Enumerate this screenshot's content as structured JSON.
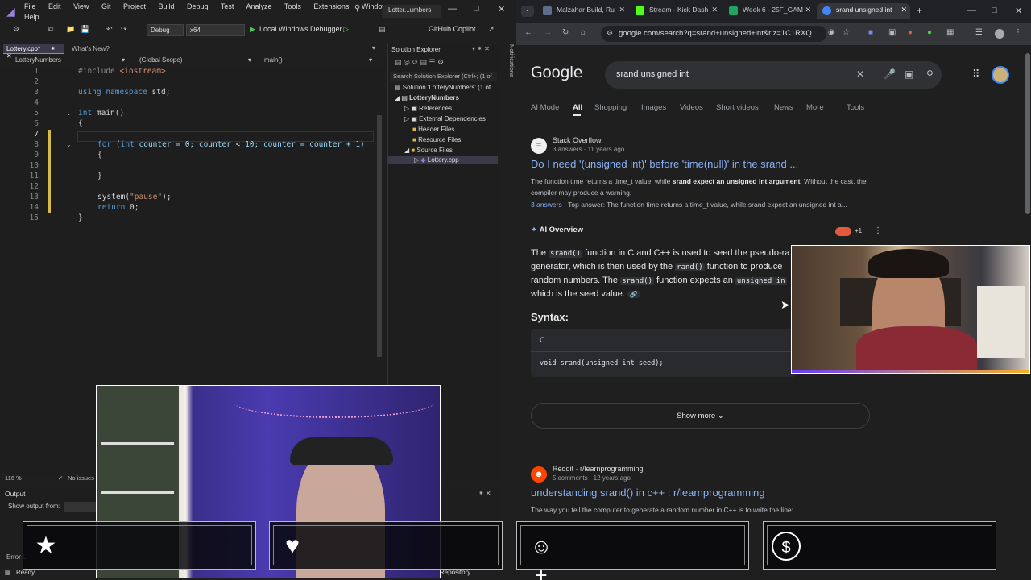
{
  "vs": {
    "menu_row1": [
      "File",
      "Edit",
      "View",
      "Git",
      "Project",
      "Build",
      "Debug",
      "Test",
      "Analyze",
      "Tools",
      "Extensions",
      "Window"
    ],
    "menu_row2": "Help",
    "search_icon": "search-icon",
    "title_short": "Lotter...umbers",
    "toolbar": {
      "config": "Debug",
      "platform": "x64",
      "run_label": "Local Windows Debugger",
      "copilot": "GitHub Copilot"
    },
    "tabs": {
      "active": "Lottery.cpp*",
      "other": "What's New?"
    },
    "nav": {
      "project": "LotteryNumbers",
      "scope": "(Global Scope)",
      "func": "main()"
    },
    "code_lines": [
      {
        "n": "1"
      },
      {
        "n": "2"
      },
      {
        "n": "3"
      },
      {
        "n": "4"
      },
      {
        "n": "5"
      },
      {
        "n": "6"
      },
      {
        "n": "7"
      },
      {
        "n": "8"
      },
      {
        "n": "9"
      },
      {
        "n": "10"
      },
      {
        "n": "11"
      },
      {
        "n": "12"
      },
      {
        "n": "13"
      },
      {
        "n": "14"
      },
      {
        "n": "15"
      }
    ],
    "code": {
      "l1a": "#include ",
      "l1b": "<iostream>",
      "l3a": "using ",
      "l3b": "namespace ",
      "l3c": "std;",
      "l5a": "int ",
      "l5b": "main()",
      "l6": "{",
      "l8a": "for ",
      "l8b": "(",
      "l8c": "int ",
      "l8d": "counter = 0; counter < 10; counter = counter + 1)",
      "l9": "{",
      "l11": "}",
      "l13a": "system(",
      "l13b": "\"pause\"",
      "l13c": ");",
      "l14a": "return ",
      "l14b": "0;",
      "l15": "}"
    },
    "solution_explorer": {
      "title": "Solution Explorer",
      "search": "Search Solution Explorer (Ctrl+; (1 of",
      "solution": "Solution 'LotteryNumbers' (1 of",
      "project": "LotteryNumbers",
      "items": [
        "References",
        "External Dependencies",
        "Header Files",
        "Resource Files",
        "Source Files"
      ],
      "file": "Lottery.cpp"
    },
    "notifications": "Notifications",
    "zoom": "116 %",
    "issues": "No issues",
    "output": {
      "title": "Output",
      "show_from": "Show output from:"
    },
    "error_list": "Error Li",
    "status_ready": "Ready",
    "repository": "Repository"
  },
  "chrome": {
    "tabs": [
      {
        "label": "Malzahar Build, Ru",
        "color": "#5f6d8a"
      },
      {
        "label": "Stream - Kick Dash",
        "color": "#53fc18"
      },
      {
        "label": "Week 6 - 25F_GAM",
        "color": "#21a366"
      },
      {
        "label": "srand unsigned int",
        "color": "#4285f4"
      }
    ],
    "url": "google.com/search?q=srand+unsigned+int&rlz=1C1RXQ...",
    "logo": "Google",
    "query": "srand unsigned int",
    "nav_tabs": [
      "AI Mode",
      "All",
      "Shopping",
      "Images",
      "Videos",
      "Short videos",
      "News",
      "More",
      "Tools"
    ],
    "result1": {
      "site": "Stack Overflow",
      "meta": "3 answers · 11 years ago",
      "title": "Do I need '(unsigned int)' before 'time(null)' in the srand ...",
      "snippet_a": "The function time returns a time_t value, while ",
      "snippet_bold": "srand expect an unsigned int argument",
      "snippet_b": ". Without the cast, the compiler may produce a warning.",
      "answers_link": "3 answers",
      "answers_text": " · Top answer: The function time returns a time_t value, while srand expect an unsigned int a..."
    },
    "ai": {
      "label": "AI Overview",
      "plus": "+1",
      "p1": "The ",
      "code1": "srand()",
      "p2": " function in C and C++ is used to seed the pseudo-ra",
      "p3": "generator, which is then used by the ",
      "code2": "rand()",
      "p4": " function to produce",
      "p5": "random numbers. The ",
      "code3": "srand()",
      "p6": " function expects an ",
      "code4": "unsigned in",
      "p7": "which is the seed value.",
      "syntax": "Syntax:",
      "lang": "C",
      "code_line": "void srand(unsigned int seed);",
      "show_more": "Show more"
    },
    "result2": {
      "site": "Reddit · r/learnprogramming",
      "meta": "5 comments · 12 years ago",
      "title": "understanding srand() in c++ : r/learnprogramming",
      "snippet": "The way you tell the computer to generate a random number in C++ is to write the line:"
    }
  },
  "overlay_icons": [
    "star-icon",
    "heart-icon",
    "add-user-icon",
    "dollar-icon"
  ]
}
